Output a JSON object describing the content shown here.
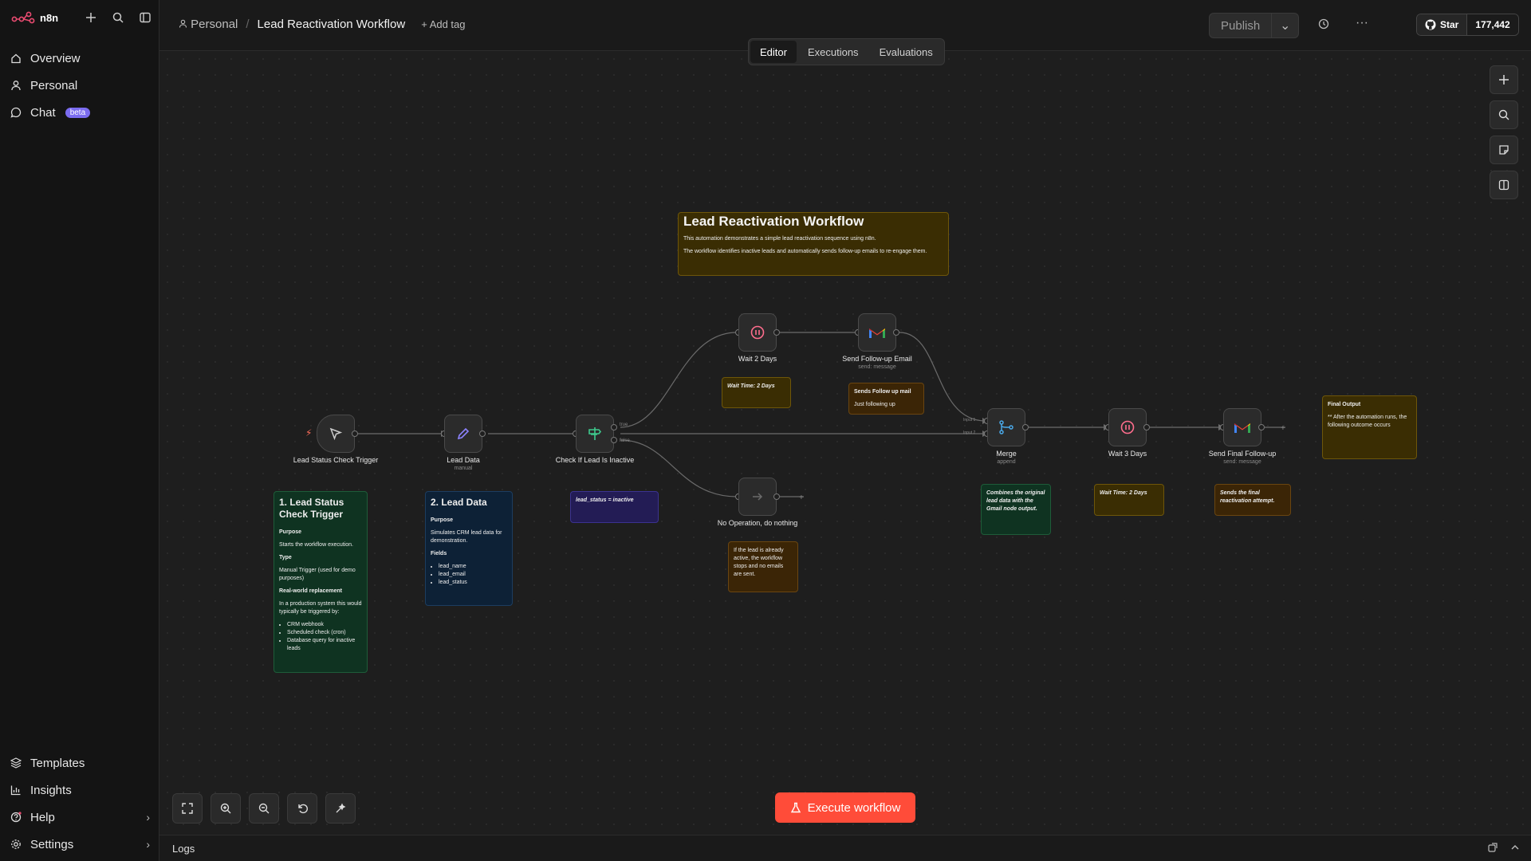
{
  "brand": {
    "name": "n8n",
    "accent": "#ea4b71"
  },
  "sidebar": {
    "items": [
      {
        "label": "Overview",
        "icon": "home-icon"
      },
      {
        "label": "Personal",
        "icon": "user-icon"
      },
      {
        "label": "Chat",
        "icon": "chat-icon",
        "badge": "beta"
      }
    ],
    "bottom": [
      {
        "label": "Templates",
        "icon": "templates-icon"
      },
      {
        "label": "Insights",
        "icon": "insights-icon"
      },
      {
        "label": "Help",
        "icon": "help-icon"
      },
      {
        "label": "Settings",
        "icon": "gear-icon"
      }
    ]
  },
  "header": {
    "project": "Personal",
    "workflow_title": "Lead Reactivation Workflow",
    "add_tag": "+ Add tag",
    "publish": "Publish",
    "github_star": "Star",
    "github_count": "177,442"
  },
  "tabs": [
    "Editor",
    "Executions",
    "Evaluations"
  ],
  "nodes": {
    "trigger": {
      "label": "Lead Status Check Trigger"
    },
    "lead_data": {
      "label": "Lead Data",
      "sub": "manual"
    },
    "check": {
      "label": "Check If Lead Is Inactive",
      "true_label": "true",
      "false_label": "false"
    },
    "wait2": {
      "label": "Wait 2 Days"
    },
    "send_followup": {
      "label": "Send Follow-up Email",
      "sub": "send: message"
    },
    "noop": {
      "label": "No Operation, do nothing"
    },
    "merge": {
      "label": "Merge",
      "sub": "append",
      "input1": "Input 1",
      "input2": "Input 2"
    },
    "wait3": {
      "label": "Wait 3 Days"
    },
    "send_final": {
      "label": "Send Final Follow-up",
      "sub": "send: message"
    }
  },
  "notes": {
    "main": {
      "title": "Lead Reactivation Workflow",
      "line1": "This automation demonstrates a simple lead reactivation sequence using n8n.",
      "line2": "The workflow identifies inactive leads and automatically sends follow-up emails to re-engage them."
    },
    "trigger": {
      "title": "1. Lead Status Check Trigger",
      "purpose_h": "Purpose",
      "purpose": "Starts the workflow execution.",
      "type_h": "Type",
      "type": "Manual Trigger (used for demo purposes)",
      "real_h": "Real-world replacement",
      "real": "In a production system this would typically be triggered by:",
      "items": [
        "CRM webhook",
        "Scheduled check (cron)",
        "Database query for inactive leads"
      ]
    },
    "lead": {
      "title": "2. Lead Data",
      "purpose_h": "Purpose",
      "purpose": "Simulates CRM lead data for demonstration.",
      "fields_h": "Fields",
      "items": [
        "lead_name",
        "lead_email",
        "lead_status"
      ]
    },
    "condition": {
      "text": "lead_status = inactive"
    },
    "wait2": {
      "text": "Wait Time: 2 Days"
    },
    "followup": {
      "title": "Sends Follow up mail",
      "text": "Just following up"
    },
    "noop": {
      "text": "If the lead is already active, the workflow stops and no emails are sent."
    },
    "merge": {
      "text": "Combines the original lead data with the Gmail node output."
    },
    "wait3": {
      "text": "Wait Time: 2 Days"
    },
    "final_send": {
      "text": "Sends the final reactivation attempt."
    },
    "final_output": {
      "title": "Final Output",
      "text": "** After the automation runs, the following outcome occurs"
    }
  },
  "footer": {
    "execute": "Execute workflow",
    "logs": "Logs"
  }
}
